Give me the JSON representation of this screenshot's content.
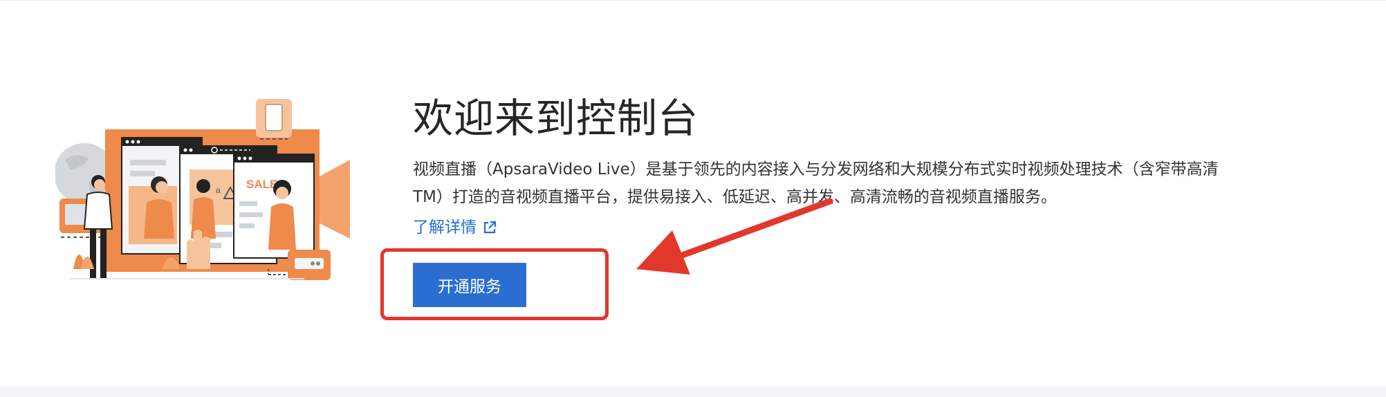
{
  "welcome": {
    "title": "欢迎来到控制台",
    "description": "视频直播（ApsaraVideo Live）是基于领先的内容接入与分发网络和大规模分布式实时视频处理技术（含窄带高清TM）打造的音视频直播平台，提供易接入、低延迟、高并发、高清流畅的音视频直播服务。",
    "learn_more_label": "了解详情",
    "primary_button_label": "开通服务",
    "illustration_sale_text": "SALE"
  },
  "colors": {
    "accent_blue": "#2b6ed2",
    "link_blue": "#1f6fd8",
    "highlight_red": "#e2372b",
    "illustration_orange": "#ee8a4a"
  },
  "icons": {
    "external_link": "external-link-icon",
    "annotation_arrow": "arrow-icon"
  }
}
